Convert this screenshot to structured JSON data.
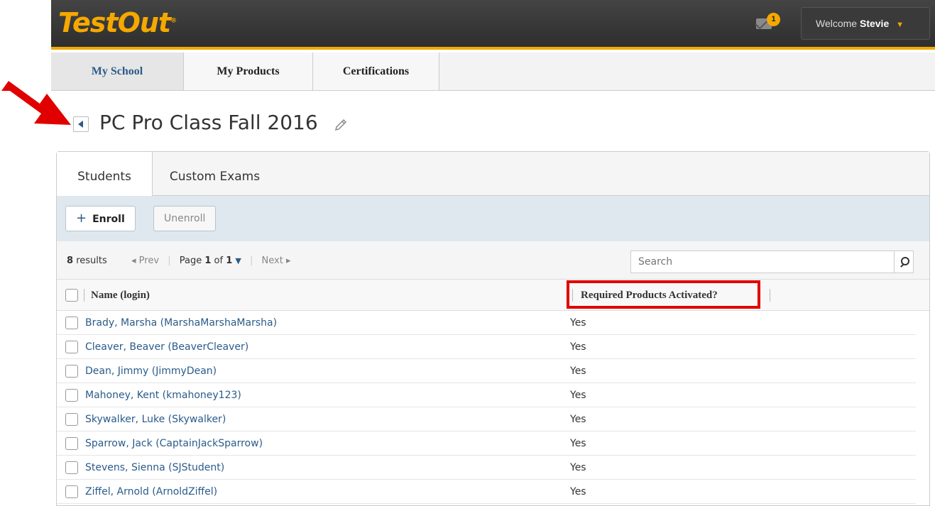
{
  "header": {
    "logo_text": "TestOut",
    "logo_mark": "®",
    "notification_count": "1",
    "welcome_prefix": "Welcome",
    "username": "Stevie"
  },
  "nav": {
    "tabs": [
      {
        "label": "My School",
        "active": true
      },
      {
        "label": "My Products",
        "active": false
      },
      {
        "label": "Certifications",
        "active": false
      }
    ]
  },
  "page": {
    "title": "PC Pro Class Fall 2016"
  },
  "subtabs": [
    {
      "label": "Students",
      "active": true
    },
    {
      "label": "Custom Exams",
      "active": false
    }
  ],
  "toolbar": {
    "enroll_label": "Enroll",
    "unenroll_label": "Unenroll"
  },
  "results": {
    "count": "8",
    "count_label": "results",
    "prev": "Prev",
    "page_word": "Page",
    "page_current": "1",
    "of_word": "of",
    "page_total": "1",
    "next": "Next",
    "search_placeholder": "Search"
  },
  "table": {
    "columns": [
      "Name (login)",
      "Required Products Activated?"
    ],
    "rows": [
      {
        "name": "Brady, Marsha (MarshaMarshaMarsha)",
        "activated": "Yes"
      },
      {
        "name": "Cleaver, Beaver (BeaverCleaver)",
        "activated": "Yes"
      },
      {
        "name": "Dean, Jimmy (JimmyDean)",
        "activated": "Yes"
      },
      {
        "name": "Mahoney, Kent (kmahoney123)",
        "activated": "Yes"
      },
      {
        "name": "Skywalker, Luke (Skywalker)",
        "activated": "Yes"
      },
      {
        "name": "Sparrow, Jack (CaptainJackSparrow)",
        "activated": "Yes"
      },
      {
        "name": "Stevens, Sienna (SJStudent)",
        "activated": "Yes"
      },
      {
        "name": "Ziffel, Arnold (ArnoldZiffel)",
        "activated": "Yes"
      }
    ]
  },
  "colors": {
    "brand_orange": "#f5a800",
    "link_blue": "#2a5b8a",
    "annotation_red": "#e00000"
  }
}
